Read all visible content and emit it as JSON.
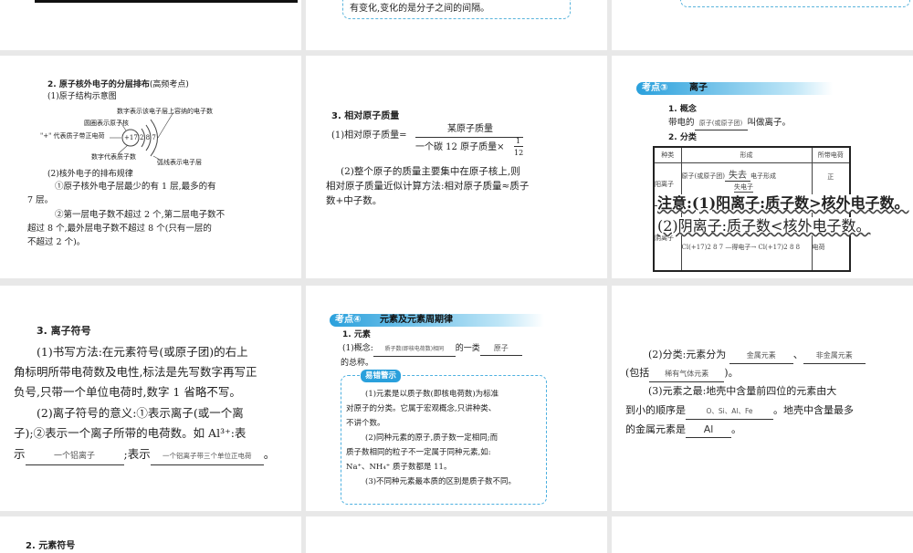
{
  "s2_top": {
    "text": "有变化,变化的是分子之间的间隔。"
  },
  "s4": {
    "title": "2. 原子核外电子的分层排布",
    "tag": "(高频考点)",
    "sub1": "(1)原子结构示意图",
    "labels": {
      "top": "数字表示该电子层上容纳的电子数",
      "nucleus": "圆圈表示原子核",
      "plus": "\"+\" 代表质子带正电荷",
      "proton": "数字代表质子数",
      "arc": "弧线表示电子层",
      "core": "+17",
      "shells": "2 8 7"
    },
    "sub2": "(2)核外电子的排布规律",
    "p1a": "①原子核外电子层最少的有 1 层,最多的有",
    "p1b": "7 层。",
    "p2a": "②第一层电子数不超过 2 个,第二层电子数不",
    "p2b": "超过 8 个,最外层电子数不超过 8 个(只有一层的",
    "p2c": "不超过 2 个)。"
  },
  "s5": {
    "title": "3. 相对原子质量",
    "f_left": "(1)相对原子质量=",
    "num": "某原子质量",
    "den": "一个碳 12 原子质量×",
    "frac_n": "1",
    "frac_d": "12",
    "p1": "(2)整个原子的质量主要集中在原子核上,则",
    "p2": "相对原子质量近似计算方法:相对原子质量≈质子",
    "p3": "数+中子数。"
  },
  "s6": {
    "badge": "考点③",
    "title": "离子",
    "h1": "1. 概念",
    "c_pre": "带电的",
    "c_fill": "原子(或原子团)",
    "c_post": "叫做离子。",
    "h2": "2. 分类",
    "th": [
      "种类",
      "形成",
      "所带电荷"
    ],
    "r1_type": "阳离子",
    "r1_form_pre": "原子(或原子团)",
    "r1_fill": "失去",
    "r1_form_post": "电子形成",
    "r1_charge": "正",
    "r1_mid": "失电子",
    "r2_type": "阴离子",
    "r2_eq": "Cl(+17)2 8 7 —得电子→ Cl(+17)2 8 8",
    "r2_charge": "电荷",
    "note1": "注意:(1)阳离子:质子数>核外电子数。",
    "note2": "(2)阴离子:质子数<核外电子数。"
  },
  "s7": {
    "title": "3. 离子符号",
    "l1": "(1)书写方法:在元素符号(或原子团)的右上",
    "l2": "角标明所带电荷数及电性,标法是先写数字再写正",
    "l3": "负号,只带一个单位电荷时,数字 1 省略不写。",
    "l4": "(2)离子符号的意义:①表示离子(或一个离",
    "l5": "子);②表示一个离子所带的电荷数。如 Al³⁺:表",
    "l6a": "示",
    "fill1": "一个铝离子",
    "l6b": ";表示",
    "fill2": "一个铝离子带三个单位正电荷",
    "l6c": "。"
  },
  "s8": {
    "badge": "考点④",
    "title": "元素及元素周期律",
    "h1": "1. 元素",
    "c_pre": "(1)概念:",
    "fill1": "质子数(即核电荷数)相同",
    "c_mid": "的一类",
    "fill2": "原子",
    "c2": "的总称。",
    "warn": "易错警示",
    "w": [
      "(1)元素是以质子数(即核电荷数)为标准",
      "对原子的分类。它属于宏观概念,只讲种类、",
      "不讲个数。",
      "(2)同种元素的原子,质子数一定相同;而",
      "质子数相同的粒子不一定属于同种元素,如:",
      "Na⁺、NH₄⁺ 质子数都是 11。",
      "(3)不同种元素最本质的区别是质子数不同。"
    ]
  },
  "s9": {
    "l1": "(2)分类:元素分为",
    "f1": "金属元素",
    "sep": "、",
    "f2": "非金属元素",
    "l2a": "(包括",
    "f3": "稀有气体元素",
    "l2b": ")。",
    "l3": "(3)元素之最:地壳中含量前四位的元素由大",
    "l4a": "到小的顺序是",
    "f4": "O、Si、Al、Fe",
    "l4b": "。地壳中含量最多",
    "l5a": "的金属元素是",
    "f5": "Al",
    "l5b": "。"
  },
  "s10": {
    "title": "2. 元素符号"
  }
}
